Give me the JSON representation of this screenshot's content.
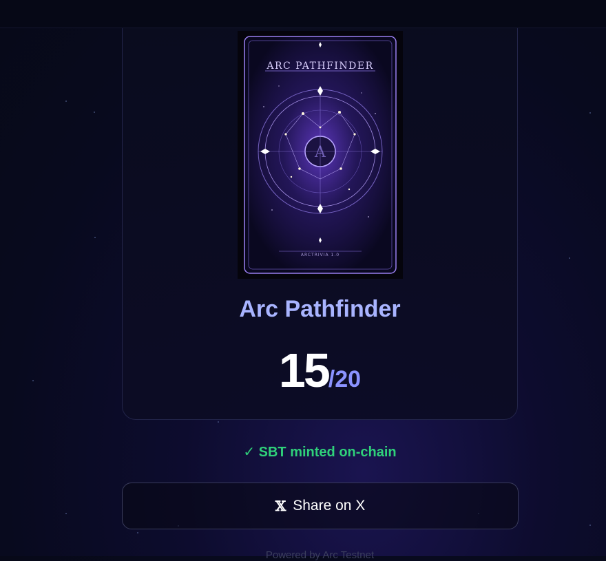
{
  "card": {
    "image_title": "ARC PATHFINDER",
    "image_footer": "ARCTRIVIA 1.0",
    "name": "Arc Pathfinder",
    "score": "15",
    "total": "/20"
  },
  "status": {
    "text": "✓ SBT minted on-chain",
    "color": "#2fd17a"
  },
  "share_button": {
    "icon": "x-logo-icon",
    "icon_glyph": "𝕏",
    "label": "Share on X"
  },
  "footer": {
    "powered_by": "Powered by Arc Testnet"
  },
  "colors": {
    "accent": "#a9b4ff",
    "total": "#8b93ff",
    "nft_purple": "#7a4dff"
  }
}
